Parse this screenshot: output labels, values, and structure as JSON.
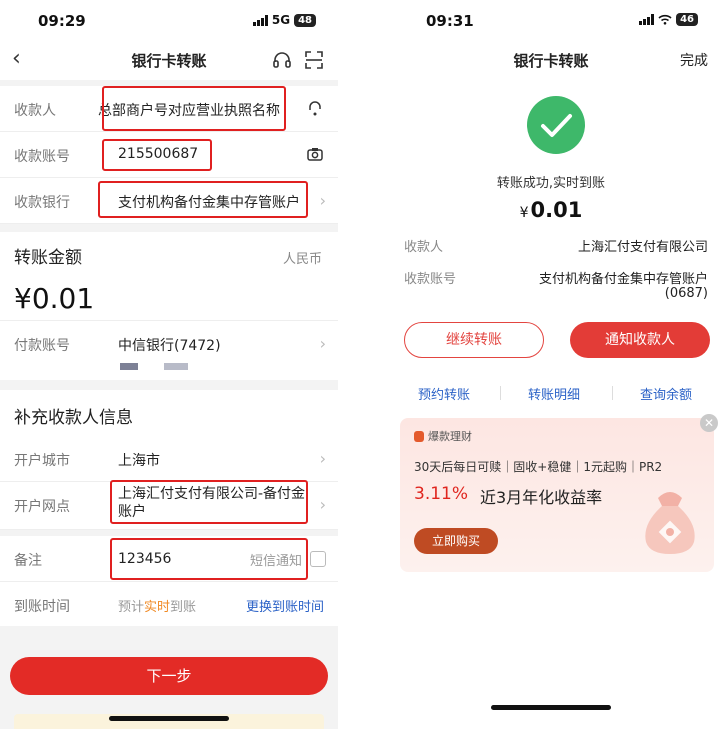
{
  "left": {
    "status": {
      "time": "09:29",
      "network": "5G",
      "battery": "48"
    },
    "nav": {
      "back_icon": "chevron-left-icon",
      "title": "银行卡转账",
      "support_icon": "headset-icon",
      "scan_icon": "scan-icon"
    },
    "payee": {
      "name_label": "收款人",
      "name_value": "总部商户号对应营业执照名称",
      "name_icon": "contact-icon",
      "account_label": "收款账号",
      "account_value": "215500687",
      "account_icon": "camera-icon",
      "bank_label": "收款银行",
      "bank_value": "支付机构备付金集中存管账户"
    },
    "amount": {
      "title": "转账金额",
      "currency": "人民币",
      "value": "¥0.01",
      "pay_account_label": "付款账号",
      "pay_account_value": "中信银行(7472)"
    },
    "extra": {
      "title": "补充收款人信息",
      "city_label": "开户城市",
      "city_value": "上海市",
      "branch_label": "开户网点",
      "branch_value": "上海汇付支付有限公司-备付金账户",
      "remark_label": "备注",
      "remark_value": "123456",
      "sms_label": "短信通知",
      "arrival_label": "到账时间",
      "arrival_pre": "预计",
      "arrival_mid": "实时",
      "arrival_post": "到账",
      "change_arrival": "更换到账时间"
    },
    "next_button": "下一步",
    "colors": {
      "brand_red": "#e32b26",
      "highlight_box": "#e02020",
      "link_blue": "#2b62c7",
      "orange": "#f08a24"
    }
  },
  "right": {
    "status": {
      "time": "09:31",
      "battery": "46"
    },
    "nav": {
      "title": "银行卡转账",
      "done": "完成"
    },
    "success_icon": "check-circle-icon",
    "success_text": "转账成功,实时到账",
    "currency_symbol": "¥",
    "amount": "0.01",
    "payee_label": "收款人",
    "payee_value": "上海汇付支付有限公司",
    "account_label": "收款账号",
    "account_value": "支付机构备付金集中存管账户",
    "account_suffix": "(0687)",
    "continue_button": "继续转账",
    "notify_button": "通知收款人",
    "links": [
      "预约转账",
      "转账明细",
      "查询余额"
    ],
    "promo": {
      "tag": "爆款理财",
      "desc": "30天后每日可赎｜固收+稳健｜1元起购｜PR2",
      "rate": "3.11%",
      "rate_label": "近3月年化收益率",
      "buy_button": "立即购买",
      "close_icon": "close-icon",
      "image_icon": "money-bag-icon"
    },
    "colors": {
      "success_green": "#3eb86a",
      "brand_red": "#e33c37"
    }
  }
}
